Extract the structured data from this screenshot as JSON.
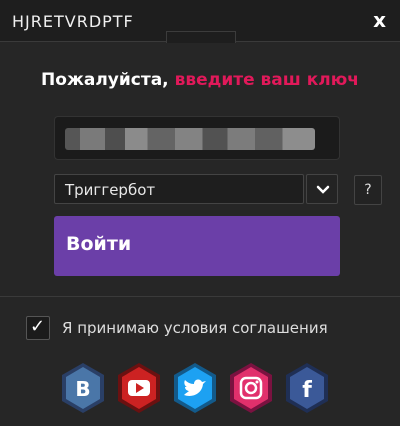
{
  "window": {
    "title": "HJRETVRDPTF",
    "close_label": "x"
  },
  "prompt": {
    "lead": "Пожалуйста,",
    "accent": "введите ваш ключ"
  },
  "key_field": {
    "value": ""
  },
  "mode_select": {
    "selected": "Триггербот",
    "chevron": "⌄"
  },
  "help_button": {
    "label": "?"
  },
  "login_button": {
    "label": "Войти"
  },
  "agreement": {
    "checked": true,
    "label": "Я принимаю условия соглашения",
    "checkmark": "✓"
  },
  "socials": [
    {
      "name": "vk",
      "glyph": "B",
      "color": "#4a76a8"
    },
    {
      "name": "youtube",
      "glyph": "▶",
      "color": "#cc2222"
    },
    {
      "name": "twitter",
      "glyph": "🐦",
      "color": "#1da1f2"
    },
    {
      "name": "instagram",
      "glyph": "◎",
      "color": "#e1306c"
    },
    {
      "name": "facebook",
      "glyph": "f",
      "color": "#3b5998"
    }
  ]
}
